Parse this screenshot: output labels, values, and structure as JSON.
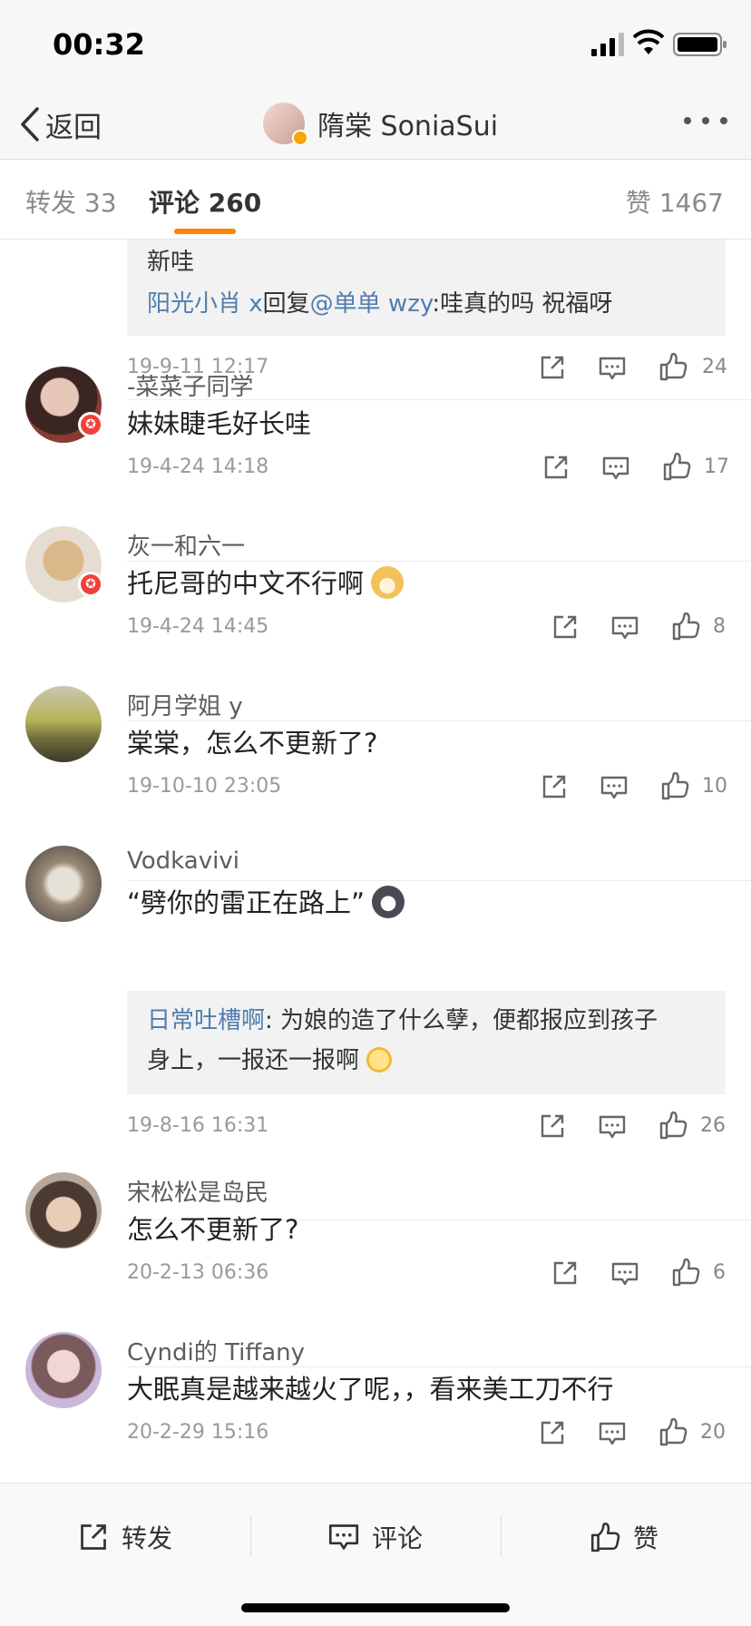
{
  "status_bar": {
    "time": "00:32"
  },
  "nav": {
    "back_label": "返回",
    "title": "隋棠 SoniaSui"
  },
  "tabs": {
    "repost": "转发 33",
    "comments": "评论 260",
    "likes": "赞 1467"
  },
  "top_reply": {
    "tail_text": "新哇",
    "reply_user": "阳光小肖 x",
    "reply_word": "回复",
    "mention": "@单单 wzy",
    "reply_text": ":哇真的吗 祝福呀",
    "date": "19-9-11 12:17",
    "likes": "24"
  },
  "comments": [
    {
      "user": "-菜菜子同学",
      "text": "妹妹睫毛好长哇",
      "date": "19-4-24 14:18",
      "likes": "17"
    },
    {
      "user": "灰一和六一",
      "text": "托尼哥的中文不行啊",
      "date": "19-4-24 14:45",
      "likes": "8"
    },
    {
      "user": "阿月学姐 y",
      "text": "棠棠，怎么不更新了?",
      "date": "19-10-10 23:05",
      "likes": "10"
    },
    {
      "user": "Vodkavivi",
      "text": "“劈你的雷正在路上”",
      "reply_user": "日常吐槽啊",
      "reply_line1": ": 为娘的造了什么孽，便都报应到孩子",
      "reply_line2": "身上，一报还一报啊",
      "date": "19-8-16 16:31",
      "likes": "26"
    },
    {
      "user": "宋松松是岛民",
      "text": "怎么不更新了?",
      "date": "20-2-13 06:36",
      "likes": "6"
    },
    {
      "user": "Cyndi的 Tiffany",
      "text": "大眠真是越来越火了呢，，看来美工刀不行",
      "date": "20-2-29 15:16",
      "likes": "20"
    }
  ],
  "bottom_bar": {
    "repost": "转发",
    "comment": "评论",
    "like": "赞"
  },
  "colors": {
    "accent": "#ff8200",
    "link": "#507daf",
    "badge_red": "#ef4136",
    "verified": "#f7a800"
  }
}
